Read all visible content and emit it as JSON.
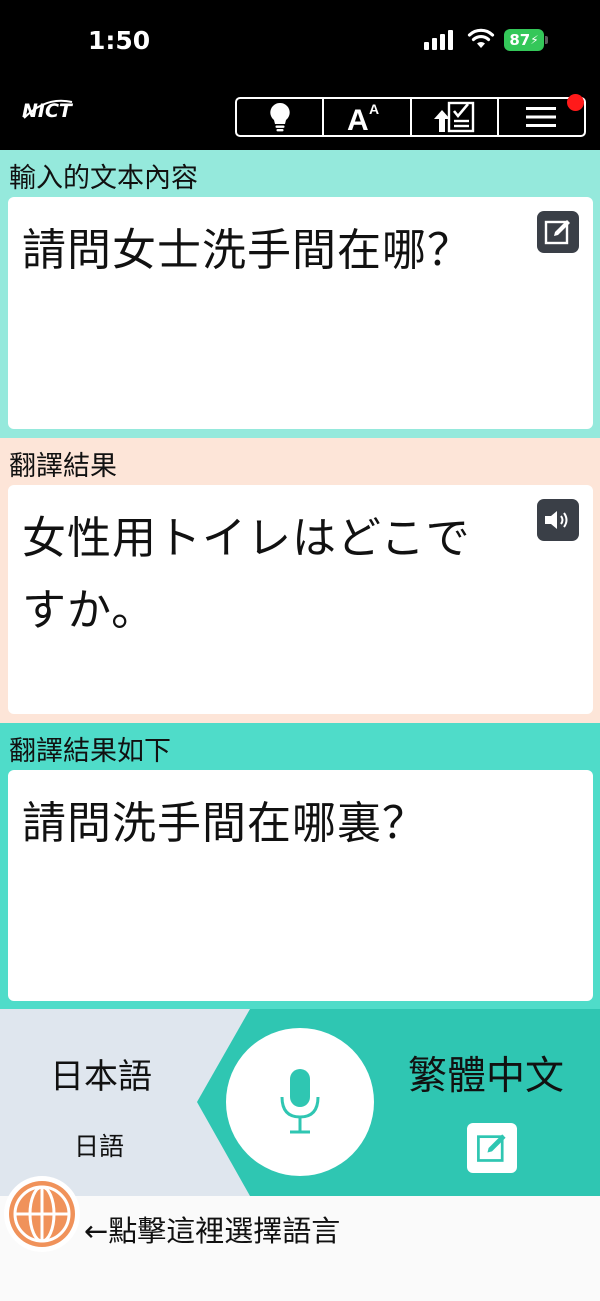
{
  "status_bar": {
    "time": "1:50",
    "battery": "87"
  },
  "header": {
    "logo": "NICT"
  },
  "input_section": {
    "label": "輸入的文本內容",
    "text": "請問女士洗手間在哪？"
  },
  "result_section": {
    "label": "翻譯結果",
    "text": "女性用トイレはどこですか。"
  },
  "back_section": {
    "label": "翻譯結果如下",
    "text": "請問洗手間在哪裏？"
  },
  "languages": {
    "source": "日本語",
    "source_native": "日語",
    "target": "繁體中文"
  },
  "footer": {
    "hint": "←點擊這裡選擇語言"
  },
  "colors": {
    "input_bg": "#95e9dc",
    "result_bg": "#fde5d8",
    "back_bg": "#4fdcc9",
    "accent": "#2fc6b2",
    "globe": "#f0925a",
    "badge": "#ff1a1a"
  }
}
